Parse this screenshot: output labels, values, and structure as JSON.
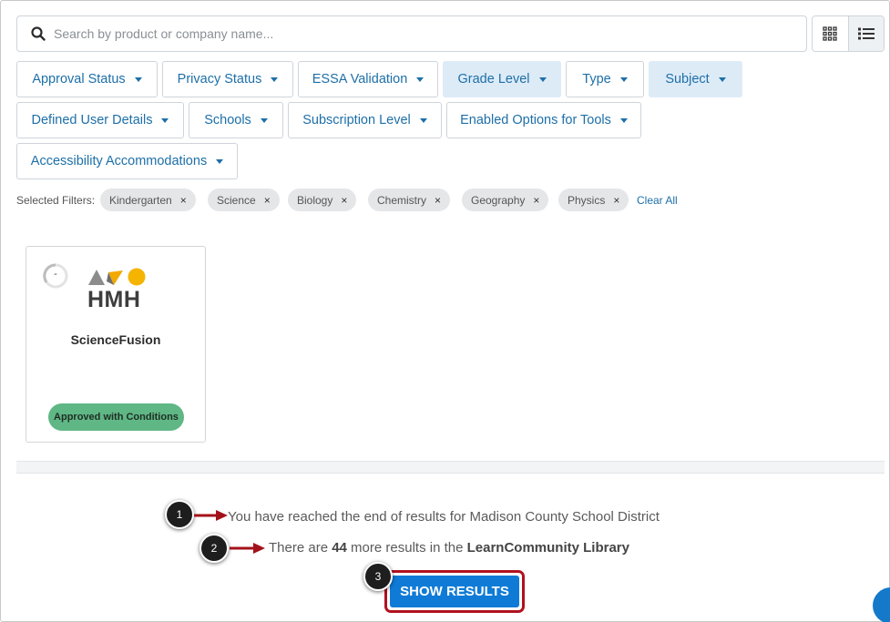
{
  "search": {
    "placeholder": "Search by product or company name..."
  },
  "view_toggle": {
    "grid_icon": "grid-icon",
    "list_icon": "list-icon",
    "active": "list"
  },
  "filters": [
    {
      "label": "Approval Status",
      "active": false
    },
    {
      "label": "Privacy Status",
      "active": false
    },
    {
      "label": "ESSA Validation",
      "active": false
    },
    {
      "label": "Grade Level",
      "active": true
    },
    {
      "label": "Type",
      "active": false
    },
    {
      "label": "Subject",
      "active": true
    },
    {
      "label": "Defined User Details",
      "active": false
    },
    {
      "label": "Schools",
      "active": false
    },
    {
      "label": "Subscription Level",
      "active": false
    },
    {
      "label": "Enabled Options for Tools",
      "active": false
    },
    {
      "label": "Accessibility Accommodations",
      "active": false
    }
  ],
  "selected_filters": {
    "label": "Selected Filters:",
    "chips": [
      "Kindergarten",
      "Science",
      "Biology",
      "Chemistry",
      "Geography",
      "Physics"
    ],
    "remove_glyph": "×",
    "clear_all": "Clear All"
  },
  "product": {
    "score": "-",
    "logo_text": "HMH",
    "name": "ScienceFusion",
    "status": "Approved with Conditions"
  },
  "results": {
    "end_message": "You have reached the end of results for Madison County School District",
    "more_prefix": "There are ",
    "more_count": "44",
    "more_middle": " more results in the ",
    "library_name": "LearnCommunity Library",
    "show_button": "SHOW RESULTS"
  },
  "callouts": [
    "1",
    "2",
    "3"
  ],
  "colors": {
    "accent": "#1d6fa8",
    "active_filter_bg": "#ddebf7",
    "badge_green": "#5fb785",
    "button_blue": "#0f7bd6",
    "highlight_red": "#b0121f",
    "arrow_red": "#a3121a"
  }
}
